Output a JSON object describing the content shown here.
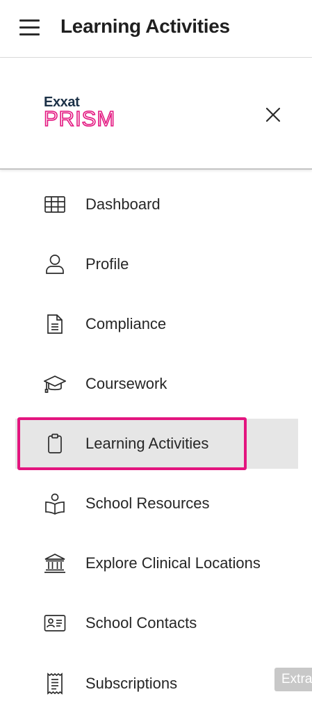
{
  "header": {
    "title": "Learning Activities",
    "menu_icon": "hamburger-menu-icon"
  },
  "drawer": {
    "logo_top": "Exxat",
    "logo_bottom": "PRISM",
    "logo_colors": {
      "top": "#1c3147",
      "bottom": "#e3157f"
    },
    "close_icon": "close-icon",
    "highlight_color": "#e3157f",
    "items": [
      {
        "label": "Dashboard",
        "icon": "grid-table-icon"
      },
      {
        "label": "Profile",
        "icon": "user-icon"
      },
      {
        "label": "Compliance",
        "icon": "document-icon"
      },
      {
        "label": "Coursework",
        "icon": "graduation-cap-icon"
      },
      {
        "label": "Learning Activities",
        "icon": "clipboard-icon",
        "active": true
      },
      {
        "label": "School Resources",
        "icon": "book-reader-icon"
      },
      {
        "label": "Explore Clinical Locations",
        "icon": "institution-icon"
      },
      {
        "label": "School Contacts",
        "icon": "contact-card-icon"
      },
      {
        "label": "Subscriptions",
        "icon": "receipt-icon"
      }
    ]
  },
  "extra_tab": "Extra"
}
